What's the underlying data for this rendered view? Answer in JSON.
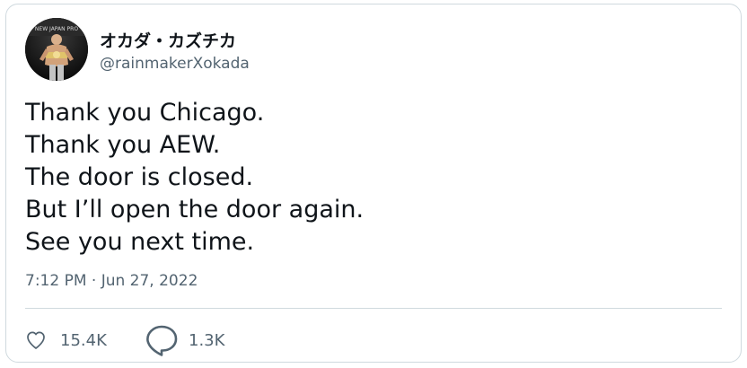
{
  "author": {
    "display_name": "オカダ・カズチカ",
    "handle": "@rainmakerXokada",
    "avatar_icon": "profile-photo"
  },
  "tweet": {
    "lines": [
      "Thank you Chicago.",
      "Thank you AEW.",
      "The door is closed.",
      "But I’ll open the door again.",
      "See you next time."
    ],
    "timestamp": "7:12 PM · Jun 27, 2022"
  },
  "actions": {
    "likes": {
      "icon": "heart-icon",
      "count": "15.4K"
    },
    "replies": {
      "icon": "speech-bubble-icon",
      "count": "1.3K"
    }
  },
  "colors": {
    "text_primary": "#0f1419",
    "text_secondary": "#536471",
    "border": "#cfd9de"
  }
}
